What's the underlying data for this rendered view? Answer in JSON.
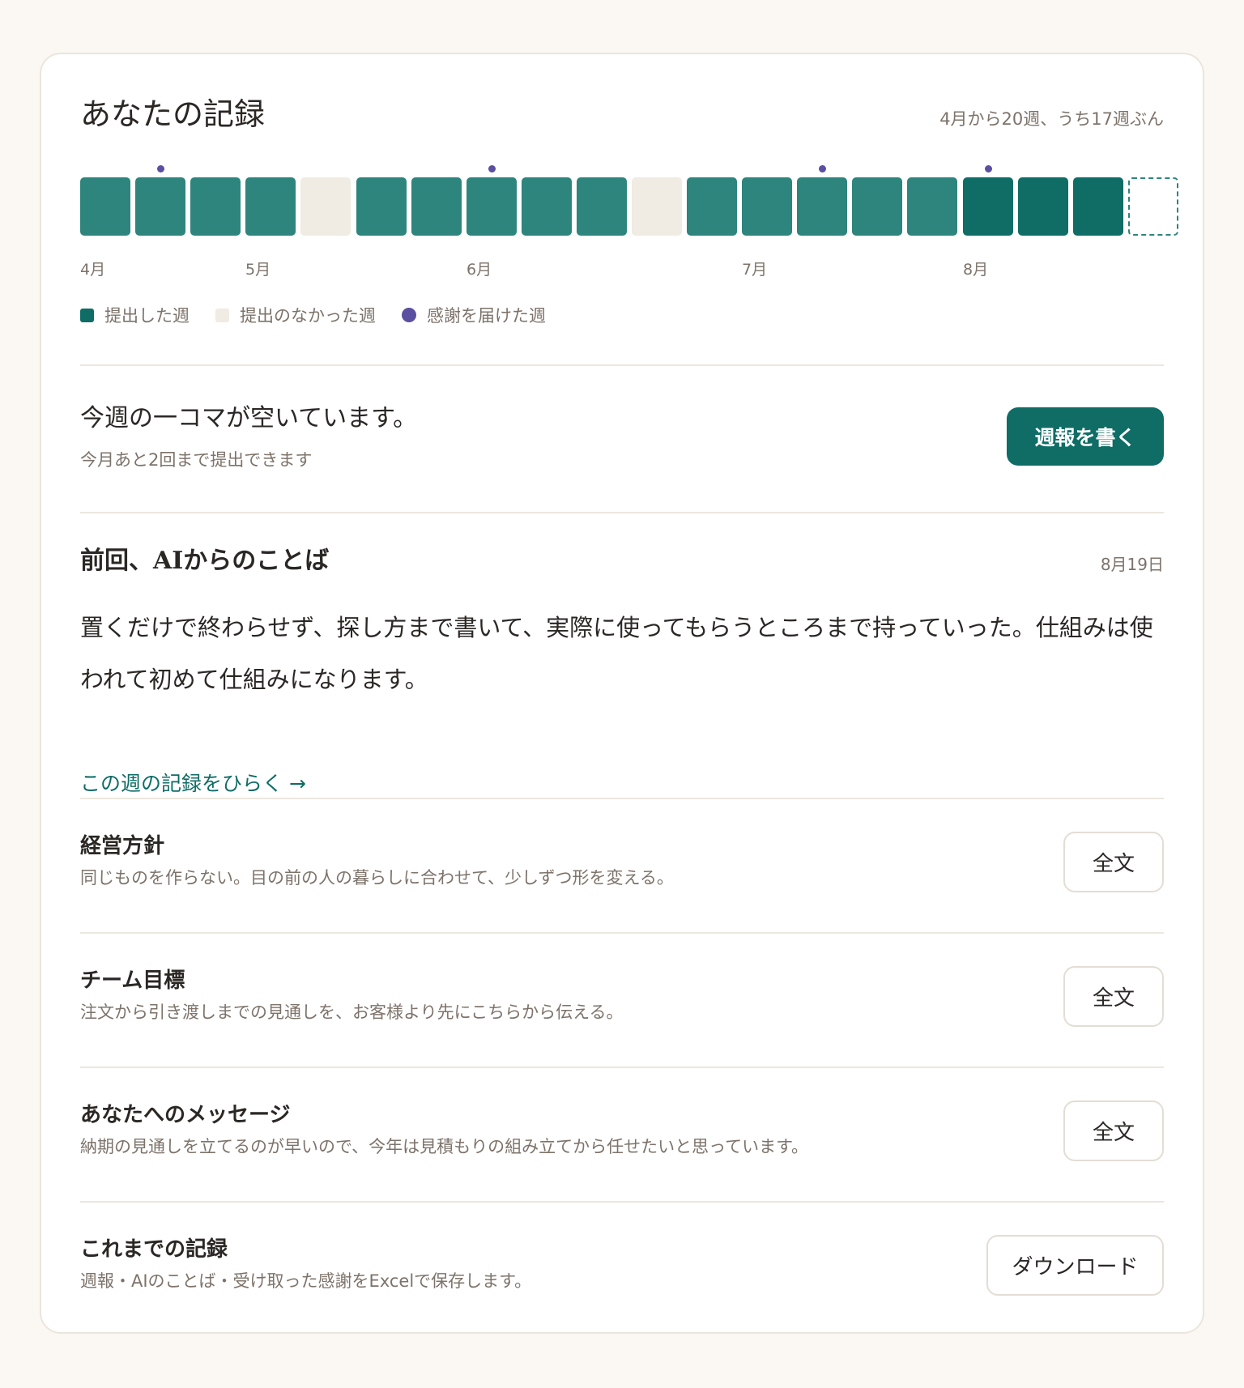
{
  "header": {
    "title": "あなたの記録",
    "summary": "4月から20週、うち17週ぶん"
  },
  "weeks": [
    {
      "status": "submitted",
      "thanks": false
    },
    {
      "status": "submitted",
      "thanks": true
    },
    {
      "status": "submitted",
      "thanks": false
    },
    {
      "status": "submitted",
      "thanks": false
    },
    {
      "status": "missed",
      "thanks": false
    },
    {
      "status": "submitted",
      "thanks": false
    },
    {
      "status": "submitted",
      "thanks": false
    },
    {
      "status": "submitted",
      "thanks": true
    },
    {
      "status": "submitted",
      "thanks": false
    },
    {
      "status": "submitted",
      "thanks": false
    },
    {
      "status": "missed",
      "thanks": false
    },
    {
      "status": "submitted",
      "thanks": false
    },
    {
      "status": "submitted",
      "thanks": false
    },
    {
      "status": "submitted",
      "thanks": true
    },
    {
      "status": "submitted",
      "thanks": false
    },
    {
      "status": "submitted",
      "thanks": false
    },
    {
      "status": "recent",
      "thanks": true
    },
    {
      "status": "recent",
      "thanks": false
    },
    {
      "status": "recent",
      "thanks": false
    },
    {
      "status": "current",
      "thanks": false
    }
  ],
  "months": [
    {
      "label": "4月",
      "week_index": 0
    },
    {
      "label": "5月",
      "week_index": 3
    },
    {
      "label": "6月",
      "week_index": 7
    },
    {
      "label": "7月",
      "week_index": 12
    },
    {
      "label": "8月",
      "week_index": 16
    }
  ],
  "legend": {
    "submitted": "提出した週",
    "missed": "提出のなかった週",
    "thanks": "感謝を届けた週"
  },
  "notice": {
    "title": "今週の一コマが空いています。",
    "subtitle": "今月あと2回まで提出できます",
    "button": "週報を書く"
  },
  "ai": {
    "title": "前回、AIからのことば",
    "date": "8月19日",
    "body": "置くだけで終わらせず、探し方まで書いて、実際に使ってもらうところまで持っていった。仕組みは使われて初めて仕組みになります。",
    "link": "この週の記録をひらく →"
  },
  "sections": [
    {
      "title": "経営方針",
      "description": "同じものを作らない。目の前の人の暮らしに合わせて、少しずつ形を変える。",
      "button": "全文"
    },
    {
      "title": "チーム目標",
      "description": "注文から引き渡しまでの見通しを、お客様より先にこちらから伝える。",
      "button": "全文"
    },
    {
      "title": "あなたへのメッセージ",
      "description": "納期の見通しを立てるのが早いので、今年は見積もりの組み立てから任せたいと思っています。",
      "button": "全文"
    },
    {
      "title": "これまでの記録",
      "description": "週報・AIのことば・受け取った感謝をExcelで保存します。",
      "button": "ダウンロード"
    }
  ]
}
